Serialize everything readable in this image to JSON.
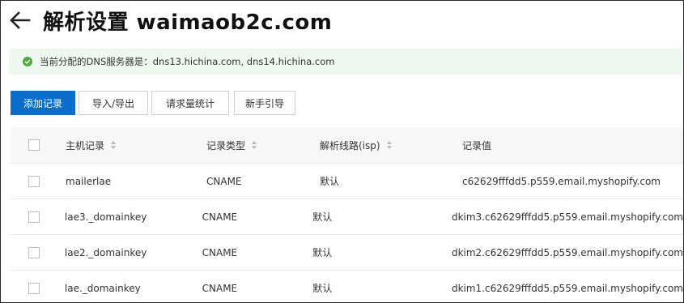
{
  "header": {
    "title": "解析设置 waimaob2c.com"
  },
  "notice": {
    "text": "当前分配的DNS服务器是：dns13.hichina.com, dns14.hichina.com",
    "color": "#52a845"
  },
  "toolbar": {
    "add_label": "添加记录",
    "import_export_label": "导入/导出",
    "request_stats_label": "请求量统计",
    "guide_label": "新手引导",
    "primary_color": "#0a6fca"
  },
  "table": {
    "columns": {
      "host": "主机记录",
      "type": "记录类型",
      "line": "解析线路(isp)",
      "value": "记录值"
    },
    "rows": [
      {
        "host": "mailerlae",
        "type": "CNAME",
        "line": "默认",
        "value": "c62629fffdd5.p559.email.myshopify.com"
      },
      {
        "host": "lae3._domainkey",
        "type": "CNAME",
        "line": "默认",
        "value": "dkim3.c62629fffdd5.p559.email.myshopify.com"
      },
      {
        "host": "lae2._domainkey",
        "type": "CNAME",
        "line": "默认",
        "value": "dkim2.c62629fffdd5.p559.email.myshopify.com"
      },
      {
        "host": "lae._domainkey",
        "type": "CNAME",
        "line": "默认",
        "value": "dkim1.c62629fffdd5.p559.email.myshopify.com"
      }
    ]
  }
}
